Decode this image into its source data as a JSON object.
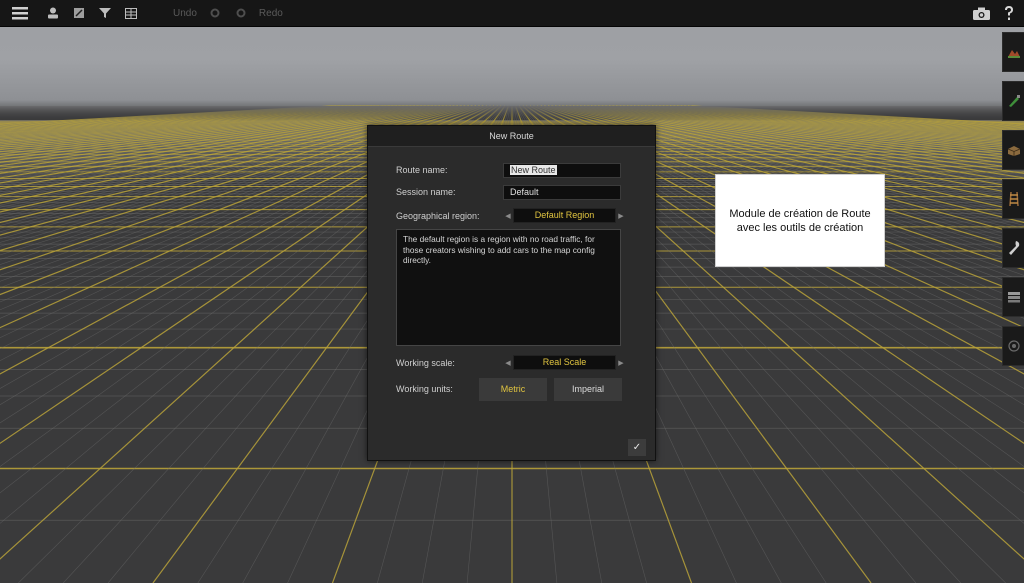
{
  "toolbar": {
    "undo_label": "Undo",
    "redo_label": "Redo"
  },
  "dialog": {
    "title": "New Route",
    "route_name_label": "Route name:",
    "route_name_value": "New Route",
    "session_name_label": "Session name:",
    "session_name_value": "Default",
    "region_label": "Geographical region:",
    "region_value": "Default Region",
    "description": "The default region is a region with no road traffic, for those creators wishing to add cars to the map config directly.",
    "scale_label": "Working scale:",
    "scale_value": "Real Scale",
    "units_label": "Working units:",
    "units_metric": "Metric",
    "units_imperial": "Imperial",
    "confirm_glyph": "✓"
  },
  "annotation": {
    "line1": "Module de création de Route",
    "line2": "avec les outils de création"
  },
  "colors": {
    "grid_line": "#b9a23a",
    "accent_text": "#e0c440",
    "toolbar_bg": "#161616"
  },
  "icons": {
    "left_toolbar": [
      "menu-icon",
      "user-icon",
      "edit-icon",
      "filter-icon",
      "grid-icon",
      "undo-gear-icon",
      "redo-gear-icon"
    ],
    "right_toolbar": [
      "camera-icon",
      "help-icon"
    ],
    "side_tools": [
      "terrain-tool-icon",
      "paint-tool-icon",
      "object-tool-icon",
      "track-tool-icon",
      "wrench-tool-icon",
      "layers-tool-icon",
      "misc-tool-icon"
    ]
  }
}
